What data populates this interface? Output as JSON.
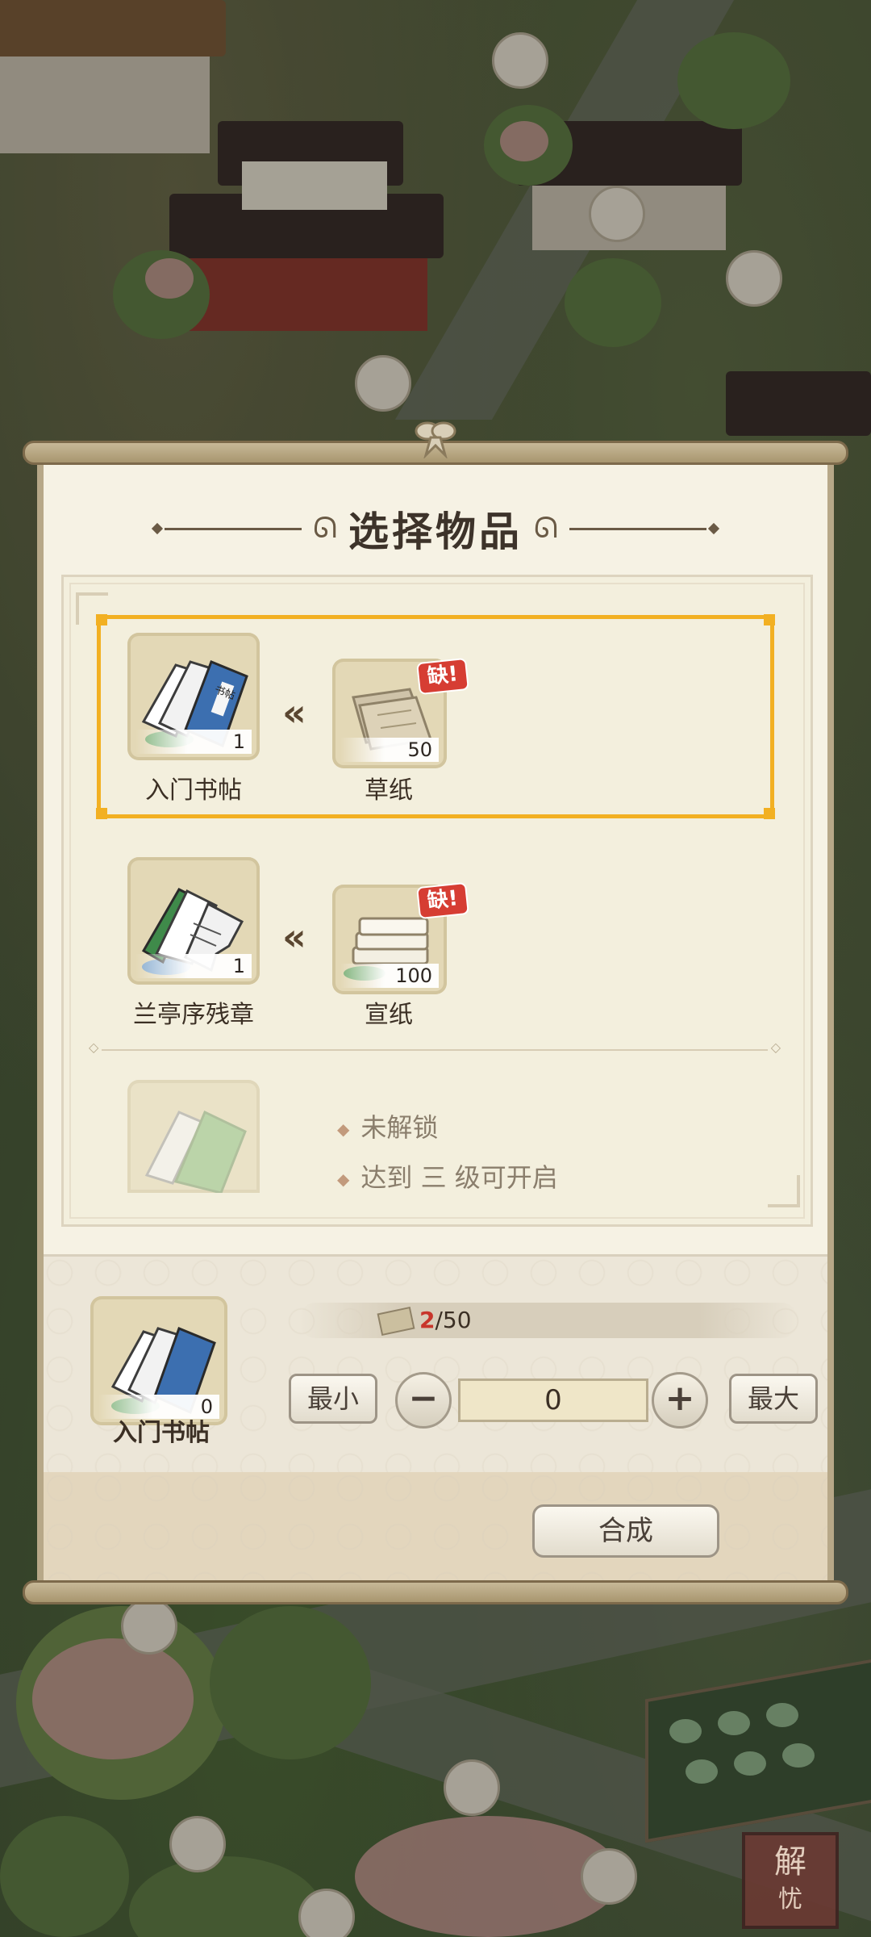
{
  "dialog": {
    "title": "选择物品"
  },
  "recipes": [
    {
      "product": {
        "name": "入门书帖",
        "count": "1",
        "icon": "blue-calligraphy-book-icon",
        "cover_text": "书帖"
      },
      "material": {
        "name": "草纸",
        "count": "50",
        "icon": "rough-paper-icon",
        "lack_badge": "缺!"
      },
      "selected": true
    },
    {
      "product": {
        "name": "兰亭序残章",
        "count": "1",
        "icon": "torn-green-book-icon"
      },
      "material": {
        "name": "宣纸",
        "count": "100",
        "icon": "xuan-paper-stack-icon",
        "lack_badge": "缺!"
      },
      "selected": false
    }
  ],
  "locked_recipe": {
    "icon": "locked-green-book-icon",
    "status": "未解锁",
    "requirement": "达到 三 级可开启"
  },
  "craft_panel": {
    "selected_name": "入门书帖",
    "selected_count": "0",
    "material_have": "2",
    "material_sep": "/",
    "material_need": "50",
    "min_label": "最小",
    "max_label": "最大",
    "minus_label": "−",
    "plus_label": "+",
    "quantity": "0",
    "craft_label": "合成"
  },
  "corner_seal": {
    "text_top": "解",
    "text_bottom": "忧"
  },
  "colors": {
    "selection": "#f2b022",
    "lack_badge": "#d63d33",
    "paper": "#f6f2e4",
    "accent_text": "#c8362c"
  }
}
